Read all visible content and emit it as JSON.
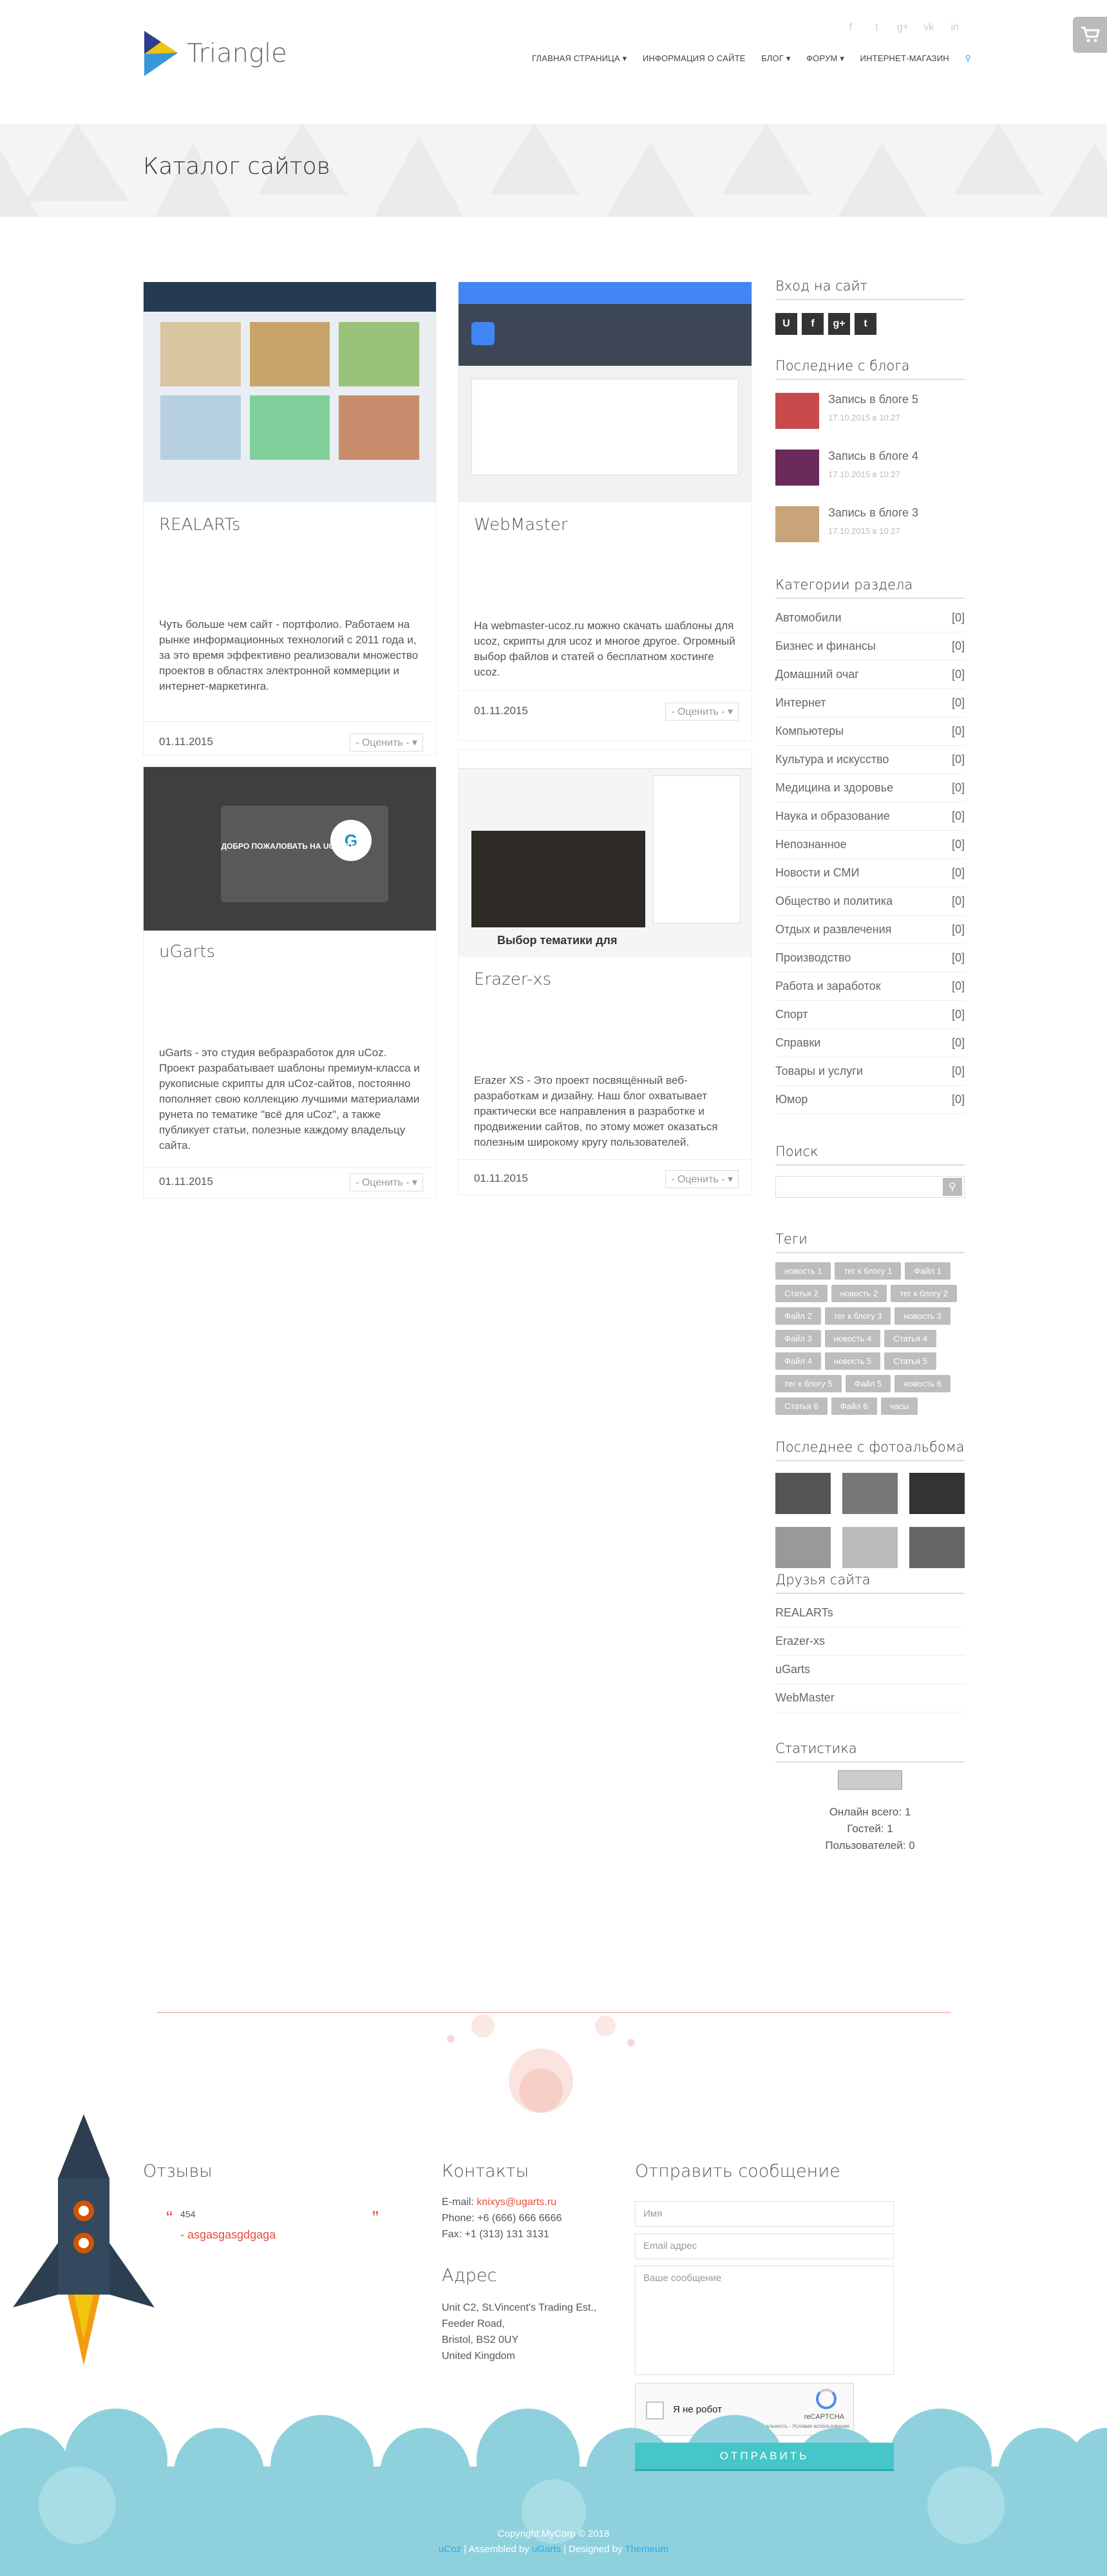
{
  "header": {
    "logo_text": "Triangle",
    "nav": [
      "ГЛАВНАЯ СТРАНИЦА",
      "ИНФОРМАЦИЯ О САЙТЕ",
      "БЛОГ",
      "ФОРУМ",
      "ИНТЕРНЕТ-МАГАЗИН"
    ],
    "social": [
      "f",
      "t",
      "g+",
      "vk",
      "in"
    ]
  },
  "page_title": "Каталог сайтов",
  "cards": [
    {
      "title": "REALARTs",
      "desc": "Чуть больше чем сайт - портфолио. Работаем на рынке информационных технологий с 2011 года и, за это время эффективно реализовали множество проектов в областях электронной коммерции и интернет-маркетинга.",
      "date": "01.11.2015",
      "rate": "- Оценить -"
    },
    {
      "title": "WebMaster",
      "desc": "На webmaster-ucoz.ru можно скачать шаблоны для ucoz, скрипты для ucoz и многое другое. Огромный выбор файлов и статей о бесплатном хостинге ucoz.",
      "date": "01.11.2015",
      "rate": "- Оценить -"
    },
    {
      "title": "uGarts",
      "desc": "uGarts - это студия вебразработок для uCoz. Проект разрабатывает шаблоны премиум-класса и рукописные скрипты для uCoz-сайтов, постоянно пополняет свою коллекцию лучшими материалами рунета по тематике \"всё для uCoz\", а также публикует статьи, полезные каждому владельцу сайта.",
      "date": "01.11.2015",
      "rate": "- Оценить -",
      "thumb_text": "ДОБРО ПОЖАЛОВАТЬ НА UGARTS!"
    },
    {
      "title": "Erazer-xs",
      "desc": "Erazer XS - Это проект посвящённый веб-разработкам и дизайну. Наш блог охватывает практически все направления в разработке и продвижении сайтов, по этому может оказаться полезным широкому кругу пользователей.",
      "date": "01.11.2015",
      "rate": "- Оценить -",
      "thumb_text": "Выбор тематики для"
    }
  ],
  "sidebar": {
    "login_title": "Вход на сайт",
    "login_buttons": [
      "U",
      "f",
      "g+",
      "t"
    ],
    "blog_title": "Последние с блога",
    "blog_posts": [
      {
        "title": "Запись в блоге 5",
        "date": "17.10.2015 в 10:27"
      },
      {
        "title": "Запись в блоге 4",
        "date": "17.10.2015 в 10:27"
      },
      {
        "title": "Запись в блоге 3",
        "date": "17.10.2015 в 10:27"
      }
    ],
    "categories_title": "Категории раздела",
    "categories": [
      {
        "name": "Автомобили",
        "count": "[0]"
      },
      {
        "name": "Бизнес и финансы",
        "count": "[0]"
      },
      {
        "name": "Домашний очаг",
        "count": "[0]"
      },
      {
        "name": "Интернет",
        "count": "[0]"
      },
      {
        "name": "Компьютеры",
        "count": "[0]"
      },
      {
        "name": "Культура и искусство",
        "count": "[0]"
      },
      {
        "name": "Медицина и здоровье",
        "count": "[0]"
      },
      {
        "name": "Наука и образование",
        "count": "[0]"
      },
      {
        "name": "Непознанное",
        "count": "[0]"
      },
      {
        "name": "Новости и СМИ",
        "count": "[0]"
      },
      {
        "name": "Общество и политика",
        "count": "[0]"
      },
      {
        "name": "Отдых и развлечения",
        "count": "[0]"
      },
      {
        "name": "Производство",
        "count": "[0]"
      },
      {
        "name": "Работа и заработок",
        "count": "[0]"
      },
      {
        "name": "Спорт",
        "count": "[0]"
      },
      {
        "name": "Справки",
        "count": "[0]"
      },
      {
        "name": "Товары и услуги",
        "count": "[0]"
      },
      {
        "name": "Юмор",
        "count": "[0]"
      }
    ],
    "search_title": "Поиск",
    "tags_title": "Теги",
    "tags": [
      "новость 1",
      "тег к блогу 1",
      "Файл 1",
      "Статья 2",
      "новость 2",
      "тег к блогу 2",
      "Файл 2",
      "тег к блогу 3",
      "новость 3",
      "Файл 3",
      "новость 4",
      "Статья 4",
      "Файл 4",
      "новость 5",
      "Статья 5",
      "тег к блогу 5",
      "Файл 5",
      "новость 6",
      "Статья 6",
      "Файл 6",
      "часы"
    ],
    "photos_title": "Последнее с фотоальбома",
    "friends_title": "Друзья сайта",
    "friends": [
      "REALARTs",
      "Erazer-xs",
      "uGarts",
      "WebMaster"
    ],
    "stats_title": "Статистика",
    "stats": [
      "Онлайн всего: 1",
      "Гостей: 1",
      "Пользователей: 0"
    ]
  },
  "footer": {
    "reviews_title": "Отзывы",
    "review_text": "454",
    "review_author": "- asgasgasgdgaga",
    "contacts_title": "Контакты",
    "email_label": "E-mail:",
    "email": "knixys@ugarts.ru",
    "phone": "Phone: +6 (666) 666 6666",
    "fax": "Fax: +1 (313) 131 3131",
    "address_title": "Адрес",
    "address": [
      "Unit C2, St.Vincent's Trading Est.,",
      "Feeder Road,",
      "Bristol, BS2 0UY",
      "United Kingdom"
    ],
    "form_title": "Отправить сообщение",
    "name_placeholder": "Имя",
    "email_placeholder": "Email адрес",
    "message_placeholder": "Ваше сообщение",
    "captcha_label": "Я не робот",
    "captcha_brand": "reCAPTCHA",
    "captcha_links": "Конфиденциальность - Условия использования",
    "submit_label": "ОТПРАВИТЬ",
    "copyright": "Copyright MyCorp © 2018",
    "credits_1": "uCoz",
    "credits_2": " | Assembled by ",
    "credits_3": "uGarts",
    "credits_4": " | Designed by ",
    "credits_5": "Themeum"
  },
  "colors": {
    "accent": "#e74c3c",
    "teal": "#45c6c8",
    "link": "#27aaf5",
    "cloud": "#8ed1dc"
  }
}
